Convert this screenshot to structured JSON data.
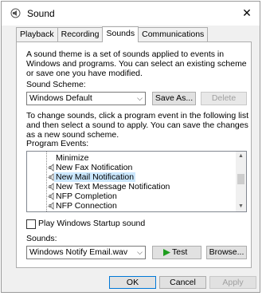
{
  "window": {
    "title": "Sound"
  },
  "tabs": [
    "Playback",
    "Recording",
    "Sounds",
    "Communications"
  ],
  "active_tab": "Sounds",
  "description": "A sound theme is a set of sounds applied to events in Windows and programs.  You can select an existing scheme or save one you have modified.",
  "sound_scheme": {
    "label": "Sound Scheme:",
    "value": "Windows Default",
    "save_as_label": "Save As...",
    "delete_label": "Delete"
  },
  "instructions": "To change sounds, click a program event in the following list and then select a sound to apply.  You can save the changes as a new sound scheme.",
  "program_events": {
    "label": "Program Events:",
    "items": [
      {
        "label": "Minimize",
        "has_sound": false,
        "selected": false
      },
      {
        "label": "New Fax Notification",
        "has_sound": true,
        "selected": false
      },
      {
        "label": "New Mail Notification",
        "has_sound": true,
        "selected": true
      },
      {
        "label": "New Text Message Notification",
        "has_sound": true,
        "selected": false
      },
      {
        "label": "NFP Completion",
        "has_sound": true,
        "selected": false
      },
      {
        "label": "NFP Connection",
        "has_sound": true,
        "selected": false
      }
    ]
  },
  "startup_sound": {
    "label": "Play Windows Startup sound",
    "checked": false
  },
  "sounds": {
    "label": "Sounds:",
    "value": "Windows Notify Email.wav",
    "test_label": "Test",
    "browse_label": "Browse..."
  },
  "footer": {
    "ok_label": "OK",
    "cancel_label": "Cancel",
    "apply_label": "Apply"
  },
  "colors": {
    "selection": "#cce8ff",
    "test_arrow": "#1e9d1e",
    "default_button_border": "#0078d7"
  }
}
